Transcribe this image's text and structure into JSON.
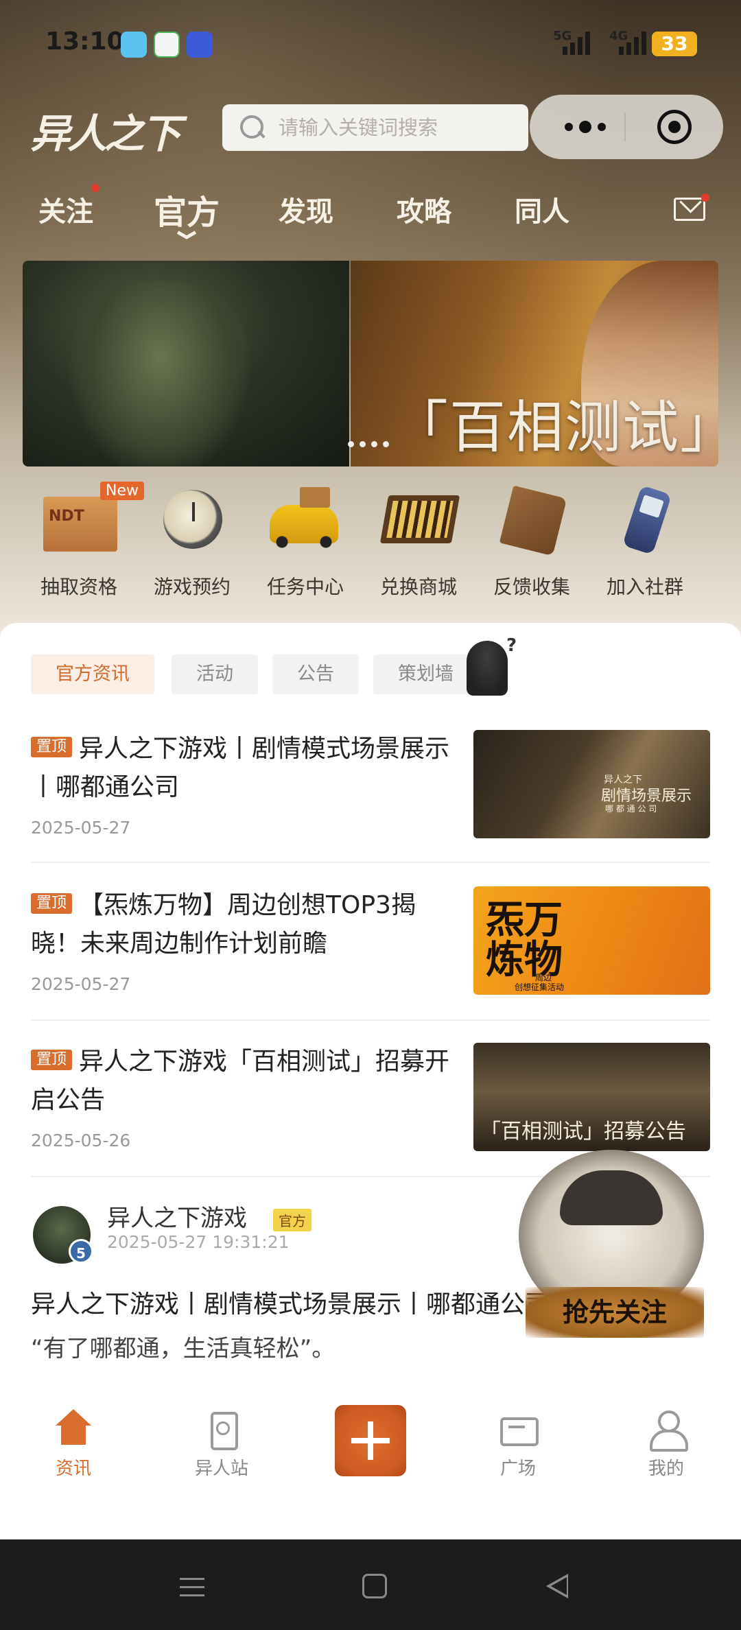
{
  "status_bar": {
    "time": "13:10",
    "network1": "5G",
    "network2": "4G",
    "battery": "33"
  },
  "header": {
    "logo_text": "异人之下",
    "search_placeholder": "请输入关键词搜索"
  },
  "nav_tabs": [
    {
      "label": "关注",
      "has_dot": true
    },
    {
      "label": "官方",
      "active": true
    },
    {
      "label": "发现"
    },
    {
      "label": "攻略"
    },
    {
      "label": "同人"
    }
  ],
  "banner": {
    "title": "「百相测试」"
  },
  "quick_entries": [
    {
      "label": "抽取资格",
      "badge": "New"
    },
    {
      "label": "游戏预约"
    },
    {
      "label": "任务中心"
    },
    {
      "label": "兑换商城"
    },
    {
      "label": "反馈收集"
    },
    {
      "label": "加入社群"
    }
  ],
  "content_tabs": [
    "官方资讯",
    "活动",
    "公告",
    "策划墙"
  ],
  "news": [
    {
      "pin": "置顶",
      "title": "异人之下游戏丨剧情模式场景展示丨哪都通公司",
      "date": "2025-05-27",
      "thumb_lines": [
        "异人之下",
        "剧情场景展示",
        "哪 都 通 公 司"
      ]
    },
    {
      "pin": "置顶",
      "title": "【炁炼万物】周边创想TOP3揭晓！未来周边制作计划前瞻",
      "date": "2025-05-27",
      "thumb_lines": [
        "炁万",
        "炼物",
        "周边",
        "创想征集活动"
      ]
    },
    {
      "pin": "置顶",
      "title": "异人之下游戏「百相测试」招募开启公告",
      "date": "2025-05-26",
      "thumb_lines": [
        "「百相测试」招募公告"
      ]
    }
  ],
  "post": {
    "author": "异人之下游戏",
    "badge": "官方",
    "level": "5",
    "time": "2025-05-27 19:31:21",
    "title": "异人之下游戏丨剧情模式场景展示丨哪都通公司",
    "desc": "“有了哪都通，生活真轻松”。"
  },
  "follow_button": "抢先关注",
  "bottom_tabs": [
    {
      "label": "资讯",
      "active": true
    },
    {
      "label": "异人站"
    },
    {
      "label": "广场"
    },
    {
      "label": "我的"
    }
  ],
  "colors": {
    "accent": "#d86d2e",
    "chip_active_bg": "#fbeee4",
    "badge_red": "#e43a2a"
  }
}
